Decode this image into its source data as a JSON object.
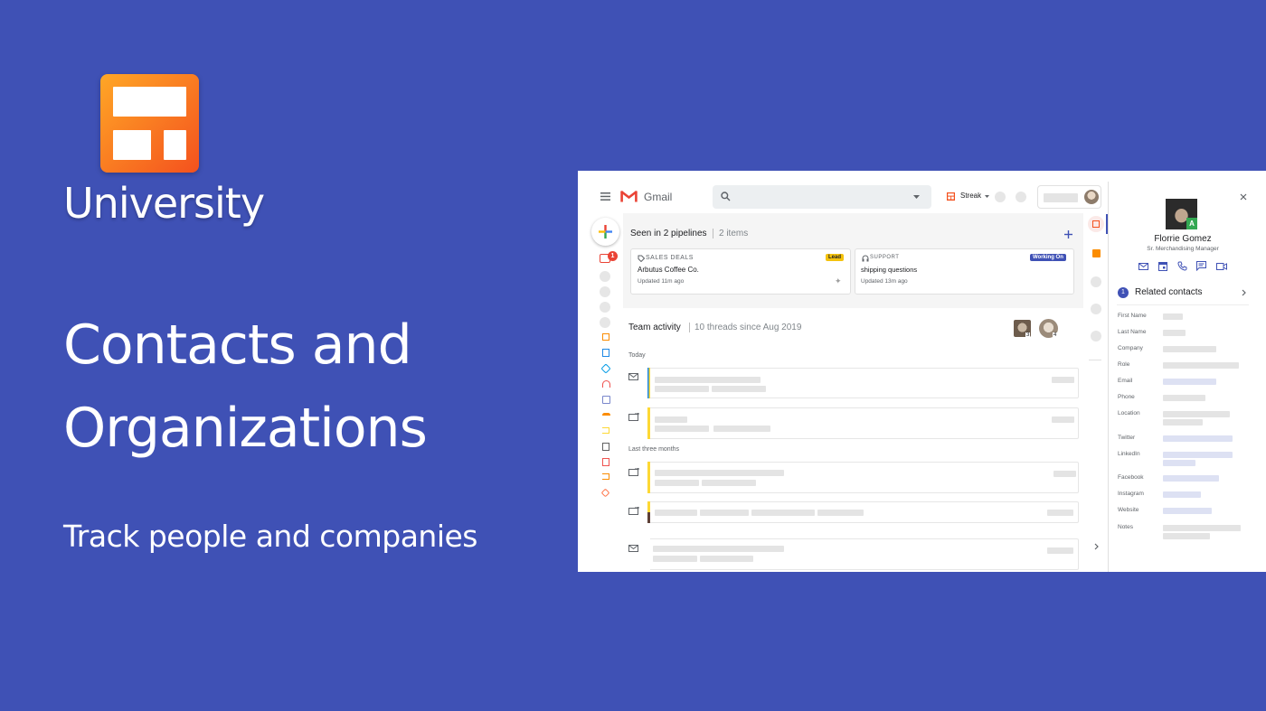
{
  "brand": {
    "university_label": "University"
  },
  "hero": {
    "title_line1": "Contacts and",
    "title_line2": "Organizations",
    "subtitle": "Track people and companies"
  },
  "gmail": {
    "app_name": "Gmail",
    "streak_label": "Streak",
    "notification_count": "1",
    "pipelines": {
      "title": "Seen in 2 pipelines",
      "count": "2 items"
    },
    "boxes": [
      {
        "pipeline": "SALES DEALS",
        "stage": "Lead",
        "name": "Arbutus Coffee Co.",
        "updated": "Updated 11m ago"
      },
      {
        "pipeline": "SUPPORT",
        "stage": "Working On",
        "name": "shipping questions",
        "updated": "Updated 13m ago"
      }
    ],
    "team": {
      "title": "Team activity",
      "summary": "10 threads since Aug 2019",
      "avatar_counts": [
        "3",
        "4"
      ]
    },
    "groups": {
      "today": "Today",
      "last_three_months": "Last three months"
    }
  },
  "contact": {
    "name": "Florrie Gomez",
    "role": "Sr. Merchandising Manager",
    "avatar_badge": "A",
    "related": {
      "count": "1",
      "label": "Related contacts"
    },
    "fields": [
      "First Name",
      "Last Name",
      "Company",
      "Role",
      "Email",
      "Phone",
      "Location",
      "Twitter",
      "LinkedIn",
      "Facebook",
      "Instagram",
      "Website",
      "Notes"
    ]
  },
  "colors": {
    "background": "#3f51b5",
    "logo_gradient_start": "#ffa726",
    "logo_gradient_end": "#f4511e",
    "stage_lead": "#f4c20d",
    "stage_working_on": "#3f51b5",
    "gmail_red": "#ea4335"
  },
  "icons": [
    "menu-icon",
    "search-icon",
    "compose-plus-icon",
    "mail-icon",
    "calendar-icon",
    "phone-icon",
    "chat-icon",
    "video-icon",
    "close-icon",
    "tag-icon",
    "headset-icon",
    "chevron-right-icon",
    "plus-icon"
  ]
}
